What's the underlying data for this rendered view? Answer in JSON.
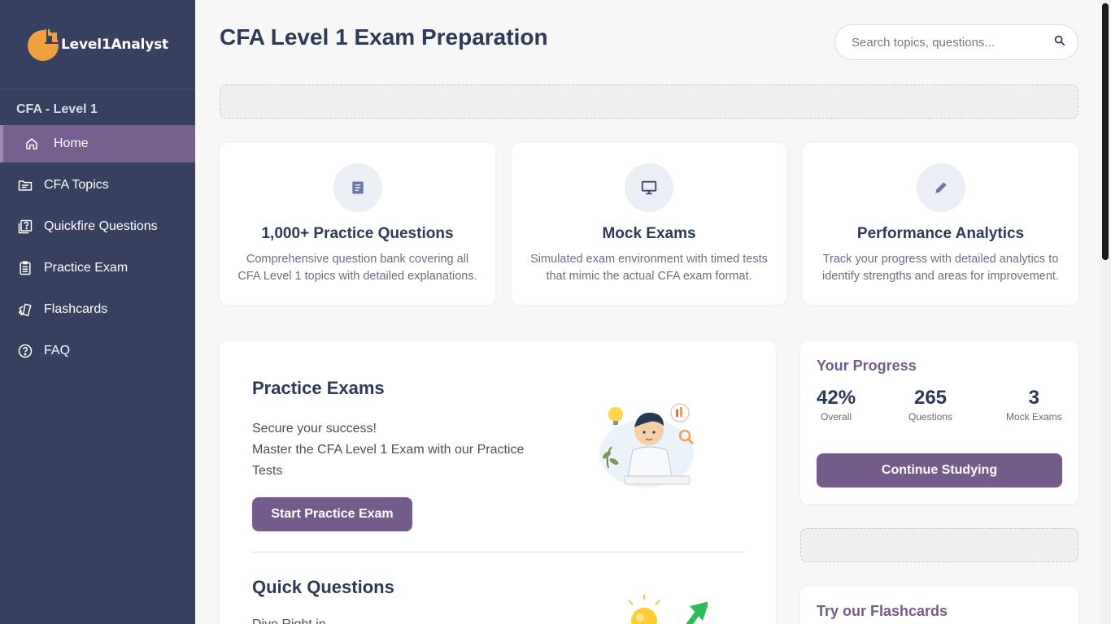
{
  "brand": {
    "name": "Level1Analyst",
    "accent": "#735c8c",
    "sidebar_bg": "#37405f",
    "logo_color": "#f0a040"
  },
  "sidebar": {
    "section_title": "CFA - Level 1",
    "items": [
      {
        "label": "Home",
        "icon": "home-icon",
        "active": true
      },
      {
        "label": "CFA Topics",
        "icon": "folder-icon"
      },
      {
        "label": "Quickfire Questions",
        "icon": "question-card-icon"
      },
      {
        "label": "Practice Exam",
        "icon": "clipboard-icon"
      },
      {
        "label": "Flashcards",
        "icon": "flashcards-icon"
      },
      {
        "label": "FAQ",
        "icon": "help-circle-icon"
      }
    ]
  },
  "header": {
    "title": "CFA Level 1 Exam Preparation",
    "search_placeholder": "Search topics, questions...",
    "search_icon": "search-icon"
  },
  "features": [
    {
      "icon": "document-icon",
      "title": "1,000+ Practice Questions",
      "desc": "Comprehensive question bank covering all CFA Level 1 topics with detailed explanations."
    },
    {
      "icon": "monitor-icon",
      "title": "Mock Exams",
      "desc": "Simulated exam environment with timed tests that mimic the actual CFA exam format."
    },
    {
      "icon": "pencil-icon",
      "title": "Performance Analytics",
      "desc": "Track your progress with detailed analytics to identify strengths and areas for improvement."
    }
  ],
  "practice": {
    "title": "Practice Exams",
    "line1": "Secure your success!",
    "line2": "Master the CFA Level 1 Exam with our Practice Tests",
    "button": "Start Practice Exam",
    "illustration": "student-thinking-illustration"
  },
  "quick": {
    "title": "Quick Questions",
    "line1": "Dive Right in",
    "illustration": "lightbulb-growth-illustration"
  },
  "progress": {
    "title": "Your Progress",
    "stats": [
      {
        "value": "42%",
        "label": "Overall"
      },
      {
        "value": "265",
        "label": "Questions"
      },
      {
        "value": "3",
        "label": "Mock Exams"
      }
    ],
    "button": "Continue Studying"
  },
  "flashcards": {
    "title": "Try our Flashcards"
  }
}
